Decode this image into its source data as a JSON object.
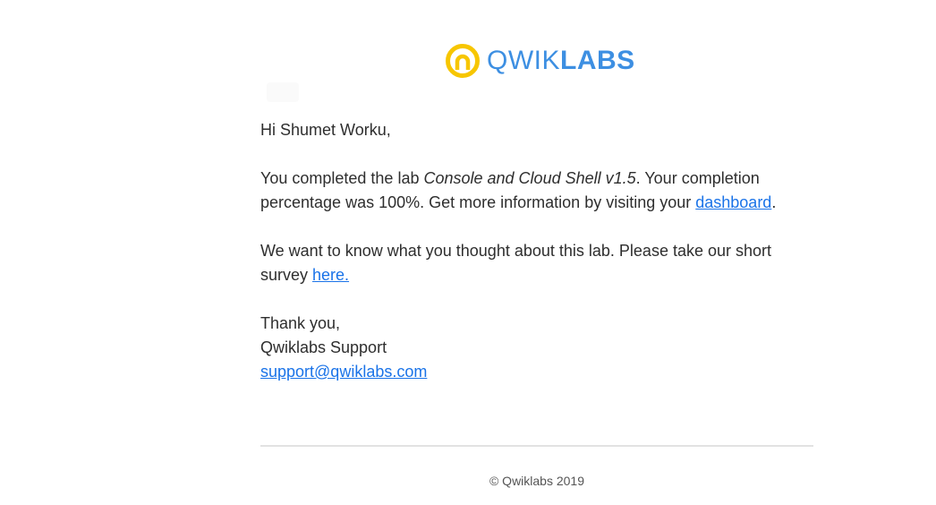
{
  "brand": {
    "name_light": "QWIK",
    "name_bold": "LABS",
    "icon": "qwiklabs-logo-icon",
    "colors": {
      "ring": "#f7c600",
      "text": "#3d8fe2",
      "link": "#1a73e8"
    }
  },
  "email": {
    "greeting": "Hi Shumet Worku,",
    "completion": {
      "before": "You completed the lab ",
      "lab_name": "Console and Cloud Shell v1.5",
      "after": ". Your completion percentage was 100%. Get more information by visiting your ",
      "link_text": "dashboard",
      "end": "."
    },
    "survey": {
      "before": "We want to know what you thought about this lab. Please take our short survey ",
      "link_text": "here."
    },
    "signoff": {
      "thanks": "Thank you,",
      "team": "Qwiklabs Support",
      "email": "support@qwiklabs.com"
    }
  },
  "footer": {
    "copyright": "© Qwiklabs 2019"
  }
}
